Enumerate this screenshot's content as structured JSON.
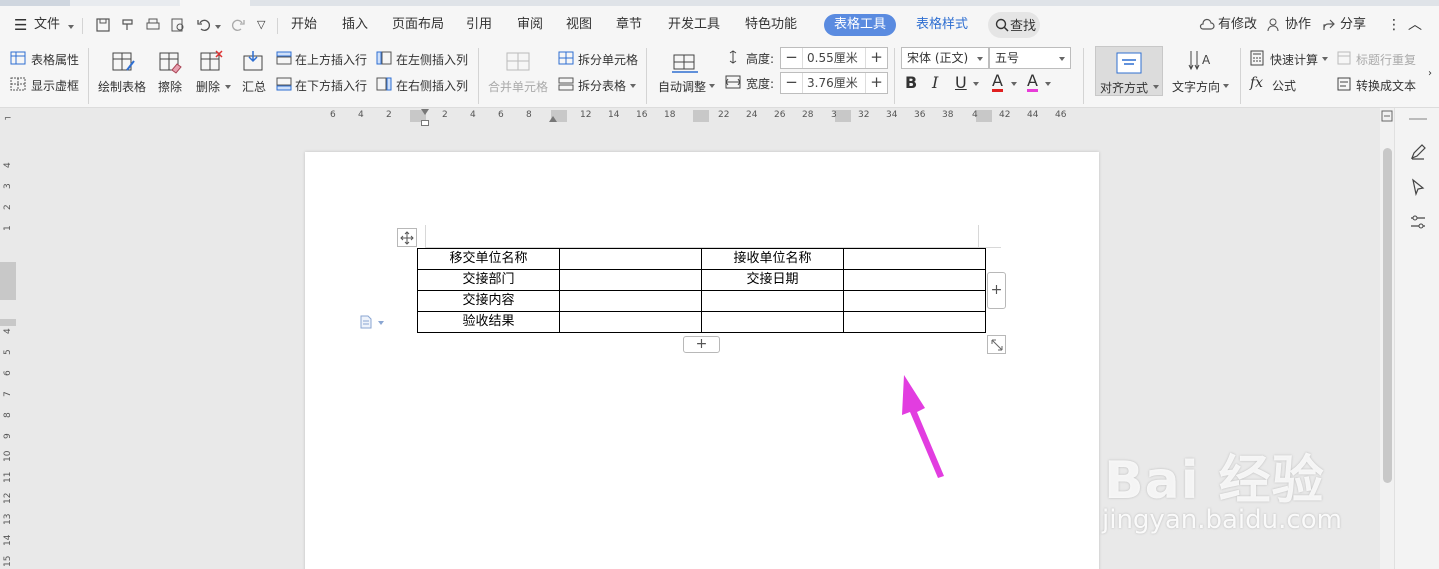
{
  "colors": {
    "accent": "#5a8be0",
    "arrow": "#e23de0",
    "tableStyleText": "#2f6fd1"
  },
  "menubar": {
    "file": "文件",
    "tabs": [
      "开始",
      "插入",
      "页面布局",
      "引用",
      "审阅",
      "视图",
      "章节",
      "开发工具",
      "特色功能"
    ],
    "table_tools": "表格工具",
    "table_style": "表格样式",
    "search": "查找",
    "has_changes": "有修改",
    "collaborate": "协作",
    "share": "分享"
  },
  "ribbon": {
    "table_props": "表格属性",
    "show_gridlines": "显示虚框",
    "draw_table": "绘制表格",
    "erase": "擦除",
    "delete": "删除",
    "summary": "汇总",
    "insert_above": "在上方插入行",
    "insert_below": "在下方插入行",
    "insert_left": "在左侧插入列",
    "insert_right": "在右侧插入列",
    "merge_cells": "合并单元格",
    "split_cells": "拆分单元格",
    "split_table": "拆分表格",
    "auto_adjust": "自动调整",
    "height_label": "高度:",
    "height_value": "0.55厘米",
    "width_label": "宽度:",
    "width_value": "3.76厘米",
    "font_name": "宋体 (正文)",
    "font_size": "五号",
    "align": "对齐方式",
    "text_direction": "文字方向",
    "quick_calc": "快速计算",
    "formula": "公式",
    "title_repeat": "标题行重复",
    "convert_text": "转换成文本",
    "bold": "B",
    "italic": "I",
    "underline": "U",
    "font_color": "A",
    "highlight": "A"
  },
  "ruler": {
    "h_ticks": [
      "6",
      "4",
      "2",
      "2",
      "4",
      "6",
      "8",
      "12",
      "14",
      "16",
      "18",
      "22",
      "24",
      "26",
      "28",
      "3",
      "32",
      "34",
      "36",
      "38",
      "4",
      "42",
      "44",
      "46"
    ],
    "v_ticks": [
      "4",
      "3",
      "2",
      "1",
      "4",
      "5",
      "6",
      "7",
      "8",
      "9",
      "10",
      "11",
      "12",
      "13",
      "14",
      "15"
    ]
  },
  "doc_table": {
    "rows": [
      [
        "移交单位名称",
        "",
        "接收单位名称",
        ""
      ],
      [
        "交接部门",
        "",
        "交接日期",
        ""
      ],
      [
        "交接内容",
        "",
        "",
        ""
      ],
      [
        "验收结果",
        "",
        "",
        ""
      ]
    ]
  },
  "watermark": {
    "main": "Bai 经验",
    "sub": "jingyan.baidu.com"
  }
}
